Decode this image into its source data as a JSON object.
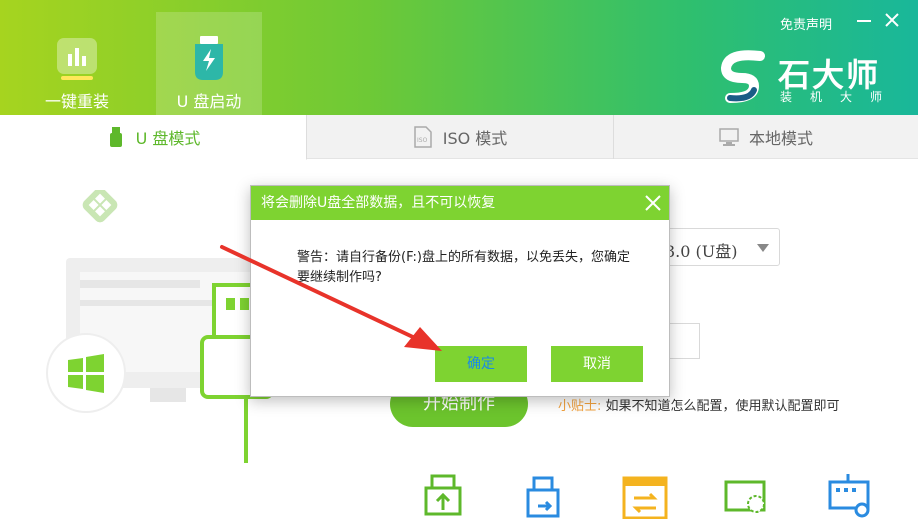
{
  "header": {
    "tabs": [
      {
        "label": "一键重装"
      },
      {
        "label": "U 盘启动"
      }
    ],
    "disclaimer": "免责声明",
    "logo": {
      "name": "石大师",
      "subtitle": "装机大师"
    }
  },
  "modes": [
    {
      "label": "U 盘模式",
      "active": true
    },
    {
      "label": "ISO 模式",
      "active": false
    },
    {
      "label": "本地模式",
      "active": false
    }
  ],
  "main": {
    "device_select": "3.0 (U盘)",
    "start_button": "开始制作",
    "tip_label": "小贴士:",
    "tip_text": "如果不知道怎么配置，使用默认配置即可"
  },
  "dialog": {
    "title": "将会删除U盘全部数据，且不可以恢复",
    "message": "警告：请自行备份(F:)盘上的所有数据，以免丢失，您确定要继续制作吗?",
    "ok_label": "确定",
    "cancel_label": "取消"
  },
  "colors": {
    "accent_green": "#7ed331",
    "header_start": "#a6d41f",
    "header_end": "#19b79a",
    "arrow_red": "#e8332a",
    "tip_orange": "#f2a13d"
  }
}
